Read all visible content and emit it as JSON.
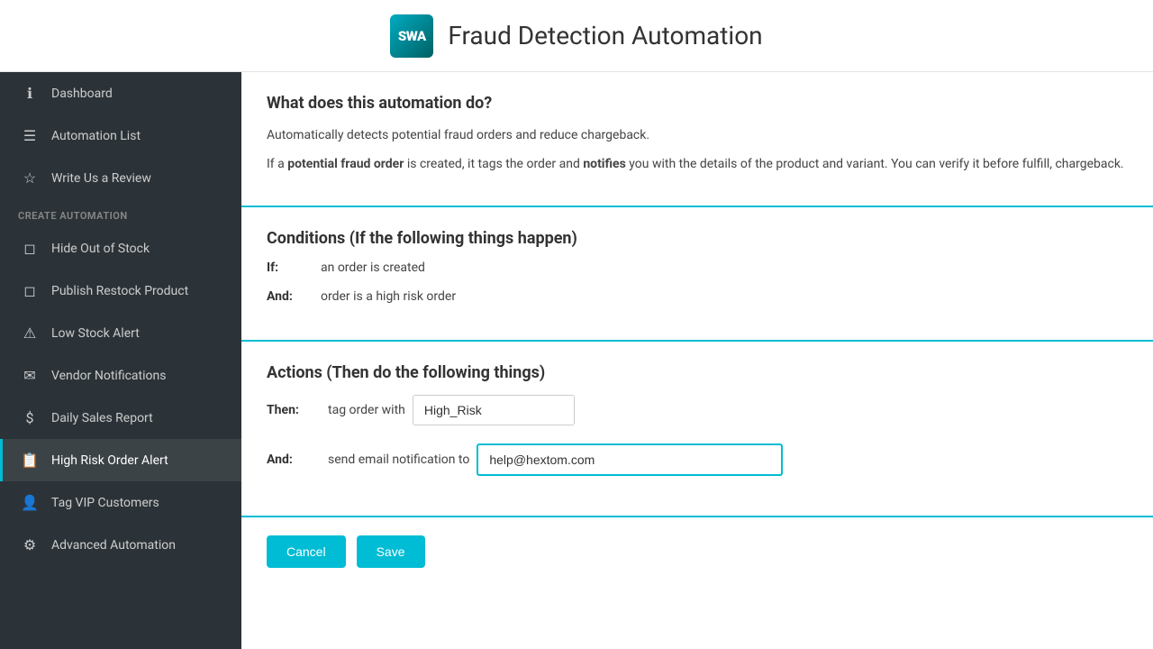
{
  "header": {
    "logo_text": "SWA",
    "title": "Fraud Detection Automation"
  },
  "sidebar": {
    "items": [
      {
        "id": "dashboard",
        "icon": "ℹ",
        "label": "Dashboard",
        "active": false
      },
      {
        "id": "automation-list",
        "icon": "☰",
        "label": "Automation List",
        "active": false
      },
      {
        "id": "write-review",
        "icon": "☆",
        "label": "Write Us a Review",
        "active": false
      }
    ],
    "section_label": "CREATE AUTOMATION",
    "automation_items": [
      {
        "id": "hide-out-of-stock",
        "icon": "📦",
        "label": "Hide Out of Stock",
        "active": false
      },
      {
        "id": "publish-restock",
        "icon": "📦",
        "label": "Publish Restock Product",
        "active": false
      },
      {
        "id": "low-stock-alert",
        "icon": "⚠",
        "label": "Low Stock Alert",
        "active": false
      },
      {
        "id": "vendor-notifications",
        "icon": "✉",
        "label": "Vendor Notifications",
        "active": false
      },
      {
        "id": "daily-sales-report",
        "icon": "$",
        "label": "Daily Sales Report",
        "active": false
      },
      {
        "id": "high-risk-order",
        "icon": "📋",
        "label": "High Risk Order Alert",
        "active": true
      },
      {
        "id": "tag-vip",
        "icon": "👤",
        "label": "Tag VIP Customers",
        "active": false
      },
      {
        "id": "advanced-automation",
        "icon": "⚙",
        "label": "Advanced Automation",
        "active": false
      }
    ]
  },
  "content": {
    "what_section": {
      "title": "What does this automation do?",
      "text1": "Automatically detects potential fraud orders and reduce chargeback.",
      "text2_prefix": "If a ",
      "text2_bold1": "potential fraud order",
      "text2_middle": " is created, it tags the order and ",
      "text2_bold2": "notifies",
      "text2_suffix": " you with the details of the product and variant. You can verify it before fulfill, chargeback."
    },
    "conditions_section": {
      "title": "Conditions (If the following things happen)",
      "if_label": "If:",
      "if_value": "an order is created",
      "and_label": "And:",
      "and_value": "order is a high risk order"
    },
    "actions_section": {
      "title": "Actions (Then do the following things)",
      "then_label": "Then:",
      "then_text": "tag order with",
      "tag_value": "High_Risk",
      "and_label": "And:",
      "and_text": "send email notification to",
      "email_value": "help@hextom.com"
    },
    "buttons": {
      "cancel": "Cancel",
      "save": "Save"
    }
  }
}
